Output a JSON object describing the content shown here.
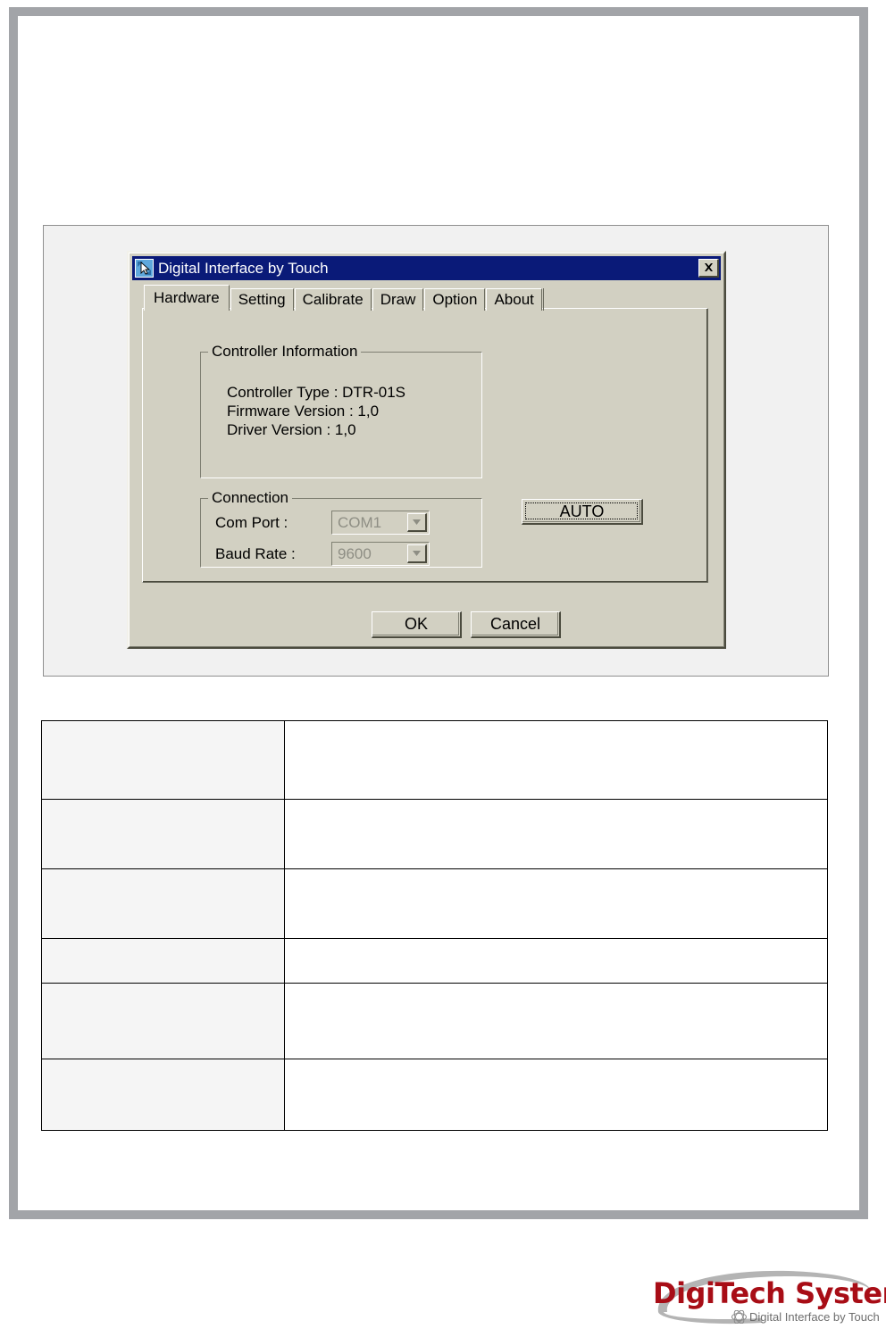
{
  "dialog": {
    "title": "Digital Interface by Touch",
    "title_icon": "touch-cursor-icon",
    "close_label": "✕",
    "tabs": [
      {
        "label": "Hardware",
        "selected": true
      },
      {
        "label": "Setting",
        "selected": false
      },
      {
        "label": "Calibrate",
        "selected": false
      },
      {
        "label": "Draw",
        "selected": false
      },
      {
        "label": "Option",
        "selected": false
      },
      {
        "label": "About",
        "selected": false
      }
    ],
    "controller_group": {
      "title": "Controller Information",
      "lines": [
        "Controller Type : DTR-01S",
        "Firmware Version : 1,0",
        "Driver  Version : 1,0"
      ],
      "controller_type_label": "Controller Type :",
      "controller_type_value": "DTR-01S",
      "firmware_version_label": "Firmware Version :",
      "firmware_version_value": "1,0",
      "driver_version_label": "Driver  Version :",
      "driver_version_value": "1,0"
    },
    "connection_group": {
      "title": "Connection",
      "com_port_label": "Com Port   :",
      "com_port_value": "COM1",
      "baud_rate_label": "Baud Rate :",
      "baud_rate_value": "9600",
      "disabled": true
    },
    "auto_button": "AUTO",
    "ok_button": "OK",
    "cancel_button": "Cancel"
  },
  "table": {
    "rows": [
      {
        "label": "",
        "value": ""
      },
      {
        "label": "",
        "value": ""
      },
      {
        "label": "",
        "value": ""
      },
      {
        "label": "",
        "value": ""
      },
      {
        "label": "",
        "value": ""
      },
      {
        "label": "",
        "value": ""
      }
    ]
  },
  "logo": {
    "title": "DigiTech Systems",
    "tagline": "Digital Interface by Touch",
    "brand_color": "#a80d16",
    "swoosh_color": "#b4b4b4"
  },
  "colors": {
    "page_frame": "#a2a4a8",
    "dialog_face": "#d2d0c2",
    "titlebar": "#0a1a78",
    "screenshot_bg": "#f1f1f1",
    "table_label_bg": "#f5f5f5",
    "disabled_text": "#8e8e84"
  }
}
